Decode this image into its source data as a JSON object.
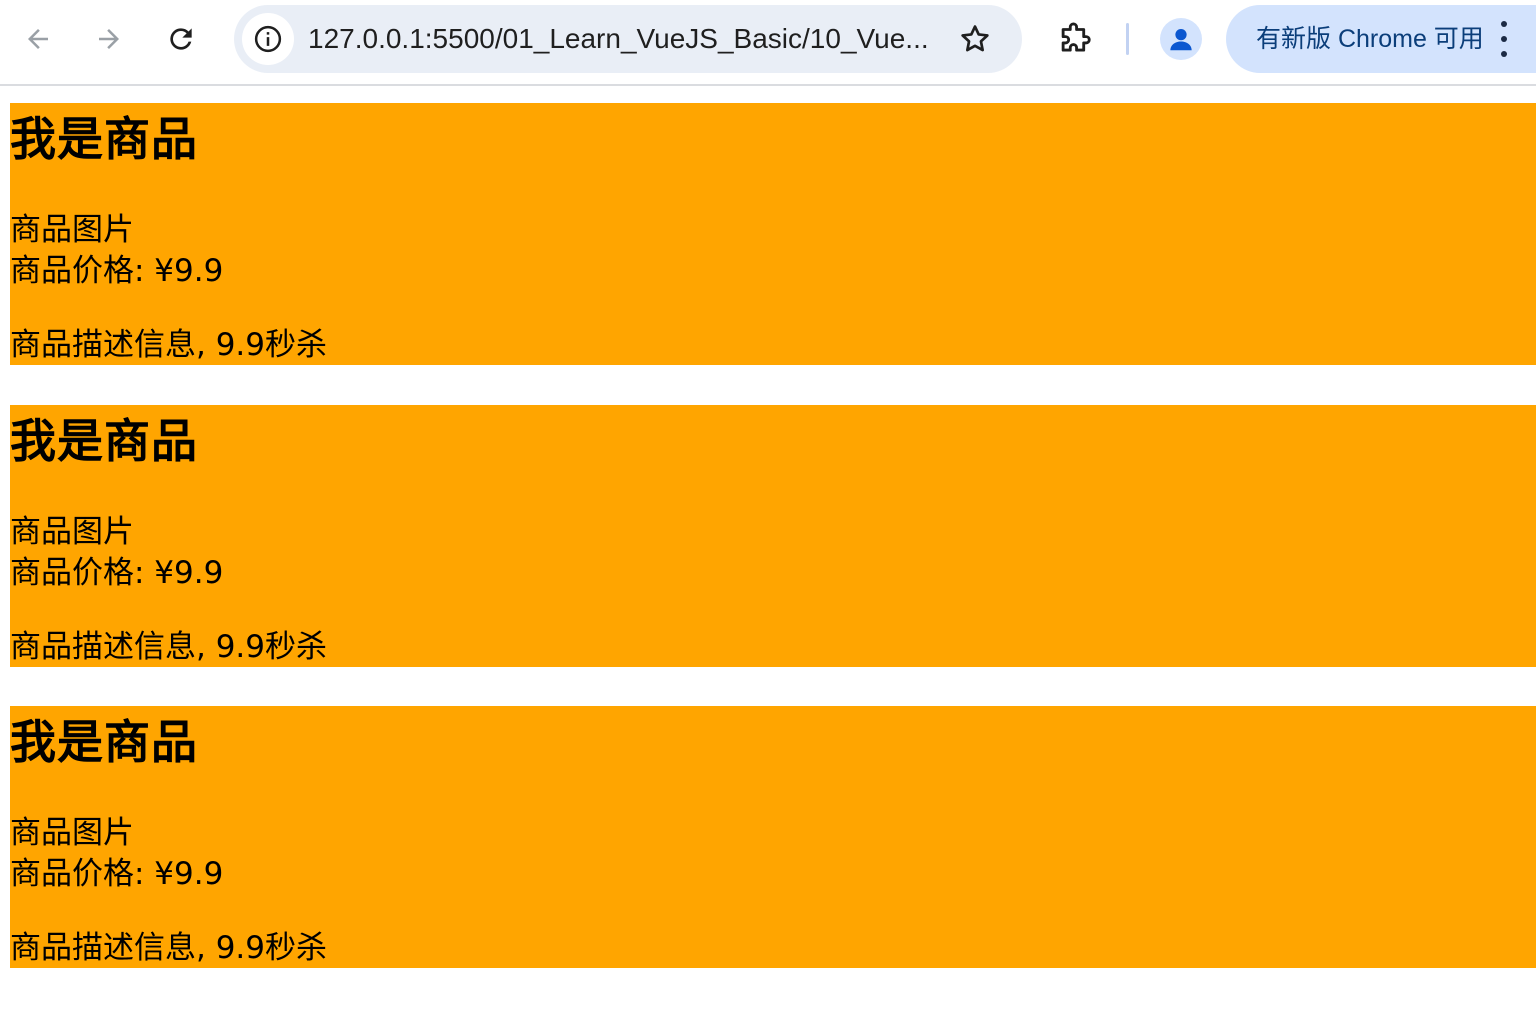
{
  "browser": {
    "url": "127.0.0.1:5500/01_Learn_VueJS_Basic/10_Vue...",
    "update_label": "有新版 Chrome 可用",
    "icons": {
      "back": "arrow-left-icon",
      "forward": "arrow-right-icon",
      "reload": "reload-icon",
      "site_info": "info-icon",
      "bookmark": "star-icon",
      "extensions": "puzzle-icon",
      "profile": "person-icon",
      "menu": "kebab-menu-icon"
    },
    "colors": {
      "omnibox_bg": "#e9eef6",
      "update_chip_bg": "#d3e3fd",
      "update_text": "#0b3e7a"
    }
  },
  "products": [
    {
      "title": "我是商品",
      "image_label": "商品图片",
      "price_label": "商品价格: ¥9.9",
      "description": "商品描述信息, 9.9秒杀"
    },
    {
      "title": "我是商品",
      "image_label": "商品图片",
      "price_label": "商品价格: ¥9.9",
      "description": "商品描述信息, 9.9秒杀"
    },
    {
      "title": "我是商品",
      "image_label": "商品图片",
      "price_label": "商品价格: ¥9.9",
      "description": "商品描述信息, 9.9秒杀"
    }
  ],
  "theme": {
    "product_bg": "#ffa500"
  }
}
